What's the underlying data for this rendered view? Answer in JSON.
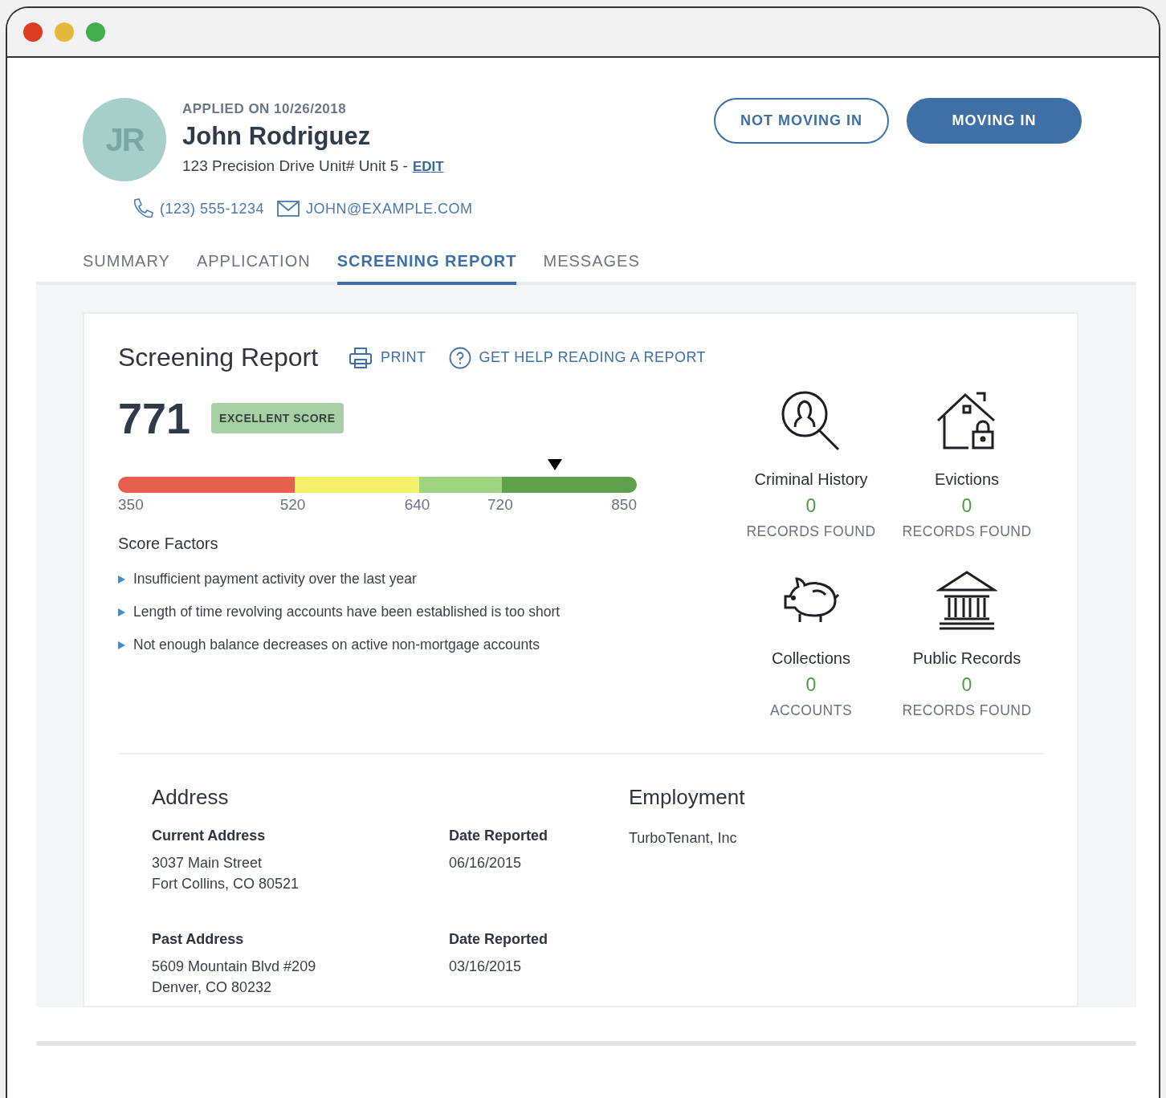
{
  "window": {
    "controls": [
      {
        "color": "#dd3e22"
      },
      {
        "color": "#e3b93c"
      },
      {
        "color": "#40ae4c"
      }
    ]
  },
  "applicant": {
    "initials": "JR",
    "applied": "APPLIED ON 10/26/2018",
    "name": "John Rodriguez",
    "address": "123 Precision Drive Unit# Unit 5 -",
    "edit": "EDIT",
    "phone": "(123) 555-1234",
    "email": "JOHN@EXAMPLE.COM"
  },
  "actions": [
    {
      "label": "NOT MOVING IN",
      "kind": "outline"
    },
    {
      "label": "MOVING IN",
      "kind": "filled"
    }
  ],
  "tabs": [
    {
      "label": "SUMMARY",
      "selected": false
    },
    {
      "label": "APPLICATION",
      "selected": false
    },
    {
      "label": "SCREENING REPORT",
      "selected": true
    },
    {
      "label": "MESSAGES",
      "selected": false
    }
  ],
  "report": {
    "title": "Screening Report",
    "links": [
      {
        "label": "PRINT",
        "kind": "print"
      },
      {
        "label": "GET HELP READING A REPORT",
        "kind": "help"
      }
    ],
    "score": "771",
    "badge": "EXCELLENT SCORE",
    "segments": [
      {
        "color": "#e5604f"
      },
      {
        "color": "#f4f36b"
      },
      {
        "color": "#a2d57f"
      },
      {
        "color": "#5ea04c"
      }
    ],
    "ticks": [
      "350",
      "520",
      "640",
      "720",
      "850"
    ],
    "factors_title": "Score Factors",
    "factors": [
      "Insufficient payment activity over the last year",
      "Length of time revolving accounts have been established is too short",
      "Not enough balance decreases on active non-mortgage accounts"
    ],
    "records": [
      {
        "kind": "criminal",
        "title": "Criminal History",
        "count": "0",
        "unit": "RECORDS FOUND"
      },
      {
        "kind": "evictions",
        "title": "Evictions",
        "count": "0",
        "unit": "RECORDS FOUND"
      },
      {
        "kind": "collections",
        "title": "Collections",
        "count": "0",
        "unit": "ACCOUNTS"
      },
      {
        "kind": "public",
        "title": "Public Records",
        "count": "0",
        "unit": "RECORDS FOUND"
      }
    ]
  },
  "address": {
    "title": "Address",
    "entries": [
      {
        "label": "Current Address",
        "lines": [
          "3037 Main Street",
          "Fort Collins, CO 80521"
        ],
        "date_label": "Date Reported",
        "date": "06/16/2015"
      },
      {
        "label": "Past Address",
        "lines": [
          "5609 Mountain Blvd #209",
          "Denver, CO 80232"
        ],
        "date_label": "Date Reported",
        "date": "03/16/2015"
      }
    ]
  },
  "employment": {
    "title": "Employment",
    "employer": "TurboTenant, Inc"
  }
}
